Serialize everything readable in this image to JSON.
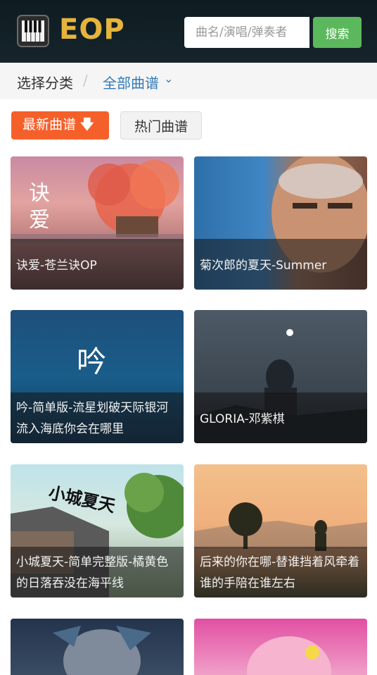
{
  "header": {
    "logo_text": "EOP",
    "search_placeholder": "曲名/演唱/弹奏者",
    "search_button": "搜索"
  },
  "breadcrumb": {
    "label": "选择分类",
    "separator": "/",
    "category": "全部曲谱",
    "caret": "⌄"
  },
  "sort": {
    "newest": "最新曲谱",
    "newest_arrow": "🡇",
    "hot": "热门曲谱"
  },
  "cards": [
    {
      "title": "诀爱-苍兰诀OP",
      "art_text": "诀爱"
    },
    {
      "title": "菊次郎的夏天-Summer"
    },
    {
      "title": "吟-简单版-流星划破天际银河流入海底你会在哪里",
      "art_text": "吟"
    },
    {
      "title": "GLORIA-邓紫棋"
    },
    {
      "title": "小城夏天-简单完整版-橘黄色的日落吞没在海平线",
      "art_text": "小城夏天"
    },
    {
      "title": "后来的你在哪-替谁挡着风牵着谁的手陪在谁左右"
    },
    {
      "title": ""
    },
    {
      "title": ""
    }
  ],
  "colors": {
    "header_bg": "#12212a",
    "logo_gold": "#e6b43c",
    "search_green": "#5cb85c",
    "accent_orange": "#f5602a",
    "link_blue": "#337ab7"
  }
}
